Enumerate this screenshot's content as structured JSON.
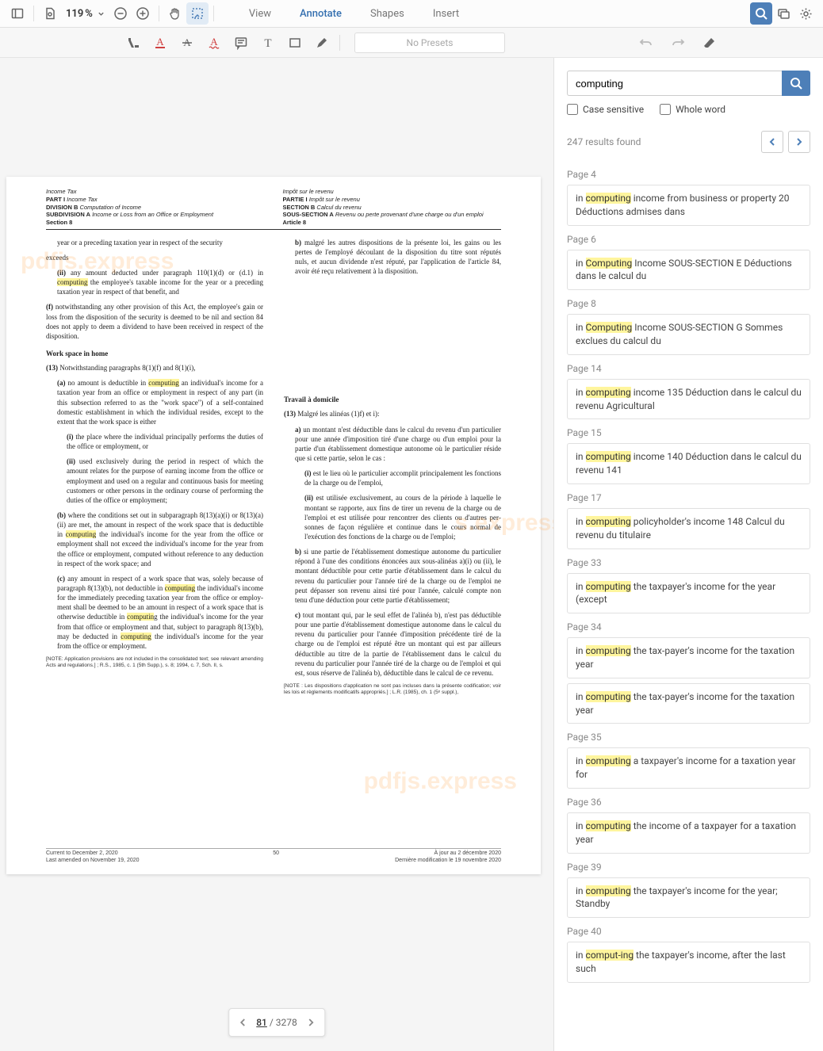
{
  "toolbar": {
    "zoom_value": "119",
    "zoom_suffix": " %",
    "modes": [
      "View",
      "Annotate",
      "Shapes",
      "Insert"
    ],
    "active_mode_index": 1,
    "presets_placeholder": "No Presets"
  },
  "pager": {
    "current": "81",
    "total": "3278"
  },
  "search": {
    "query": "computing",
    "case_sensitive_label": "Case sensitive",
    "whole_word_label": "Whole word",
    "results_count_text": "247 results found"
  },
  "results": [
    {
      "page": "Page 4",
      "items": [
        {
          "pre": "in ",
          "hl": "computing",
          "post": " income from business or property 20 Déductions admises dans"
        }
      ]
    },
    {
      "page": "Page 6",
      "items": [
        {
          "pre": "in ",
          "hl": "Computing",
          "post": " Income SOUS-SECTION E Déductions dans le calcul du"
        }
      ]
    },
    {
      "page": "Page 8",
      "items": [
        {
          "pre": "in ",
          "hl": "Computing",
          "post": " Income SOUS-SECTION G Sommes exclues du calcul du"
        }
      ]
    },
    {
      "page": "Page 14",
      "items": [
        {
          "pre": "in ",
          "hl": "computing",
          "post": " income 135 Déduction dans le calcul du revenu Agricultural"
        }
      ]
    },
    {
      "page": "Page 15",
      "items": [
        {
          "pre": "in ",
          "hl": "computing",
          "post": " income 140 Déduction dans le calcul du revenu 141"
        }
      ]
    },
    {
      "page": "Page 17",
      "items": [
        {
          "pre": "in ",
          "hl": "computing",
          "post": " policyholder's income 148 Calcul du revenu du titulaire"
        }
      ]
    },
    {
      "page": "Page 33",
      "items": [
        {
          "pre": "in ",
          "hl": "computing",
          "post": " the taxpayer's income for the year (except"
        }
      ]
    },
    {
      "page": "Page 34",
      "items": [
        {
          "pre": "in ",
          "hl": "computing",
          "post": " the tax-payer's income for the taxation year"
        },
        {
          "pre": "in ",
          "hl": "computing",
          "post": " the tax-payer's income for the taxation year"
        }
      ]
    },
    {
      "page": "Page 35",
      "items": [
        {
          "pre": "in ",
          "hl": "computing",
          "post": " a taxpayer's income for a taxation year for"
        }
      ]
    },
    {
      "page": "Page 36",
      "items": [
        {
          "pre": "in ",
          "hl": "computing",
          "post": " the income of a taxpayer for a taxation year"
        }
      ]
    },
    {
      "page": "Page 39",
      "items": [
        {
          "pre": "in ",
          "hl": "computing",
          "post": " the taxpayer's income for the year; Standby"
        }
      ]
    },
    {
      "page": "Page 40",
      "items": [
        {
          "pre": "in ",
          "hl": "comput-ing",
          "post": " the taxpayer's income, after the last such"
        }
      ]
    }
  ],
  "doc": {
    "header_left": {
      "l1": "Income Tax",
      "l2": "PART I",
      "l2t": " Income Tax",
      "l3": "DIVISION B",
      "l3t": " Computation of Income",
      "l4": "SUBDIVISION A",
      "l4t": " Income or Loss from an Office or Employment",
      "l5": "Section 8"
    },
    "header_right": {
      "l1": "Impôt sur le revenu",
      "l2": "PARTIE I",
      "l2t": " Impôt sur le revenu",
      "l3": "SECTION B",
      "l3t": " Calcul du revenu",
      "l4": "SOUS-SECTION A",
      "l4t": " Revenu ou perte provenant d'une charge ou d'un emploi",
      "l5": "Article 8"
    },
    "left": {
      "p1": "year or a preceding taxation year in respect of the security",
      "exceeds": "exceeds",
      "p_ii_a": "(ii)",
      "p_ii_b": " any amount deducted under paragraph 110(1)(d) or (d.1) in ",
      "p_ii_hl": "computing",
      "p_ii_c": " the employee's tax­able income for the year or a preceding taxation year in respect of that benefit, and",
      "p_f": "(f)",
      "p_f_t": " notwithstanding any other provision of this Act, the employee's gain or loss from the disposition of the security is deemed to be nil and section 84 does not apply to deem a dividend to have been received in re­spect of the disposition.",
      "head": "Work space in home",
      "p13": "(13)",
      "p13t": "  Notwithstanding paragraphs 8(1)(f) and 8(1)(i),",
      "pa_a": "(a)",
      "pa_b": "  no amount is deductible in ",
      "pa_hl": "computing",
      "pa_c": " an individu­al's income for a taxation year from an office or em­ployment in respect of any part (in this subsection re­ferred to as the \"work space\") of a self-contained domestic establishment in which the individual re­sides, except to the extent that the work space is either",
      "pi": "(i)",
      "pi_t": " the place where the individual principally per­forms the duties of the office or employment, or",
      "pii": "(ii)",
      "pii_t": " used exclusively during the period in respect of which the amount relates for the purpose of earning income from the office or employment and used on a regular and continuous basis for meeting cus­tomers or other persons in the ordinary course of performing the duties of the office or employment;",
      "pb_a": "(b)",
      "pb_b": "  where the conditions set out in subparagraph 8(13)(a)(i) or 8(13)(a)(ii) are met, the amount in re­spect of the work space that is deductible in ",
      "pb_hl1": "comput­ing",
      "pb_c": " the individual's income for the year from the office or employment shall not exceed the individual's in­come for the year from the office or employment, com­puted without reference to any deduction in respect of the work space; and",
      "pc_a": "(c)",
      "pc_b": "  any amount in respect of a work space that was, solely because of paragraph 8(13)(b), not deductible in ",
      "pc_hl1": "computing",
      "pc_c": " the individual's income for the immediate­ly preceding taxation year from the office or employ­ment shall be deemed to be an amount in respect of a work space that is otherwise deductible in ",
      "pc_hl2": "computin",
      "pc_d": "g the individual's income for the year from that office or employment and that, subject to paragraph 8(13)(b), may be deducted in ",
      "pc_hl3": "computing",
      "pc_e": " the individual's income for the year from the office or employment.",
      "note": "[NOTE: Application provisions are not included in the consolidated text; see relevant amending Acts and regulations.] ; R.S., 1985, c. 1 (5th Supp.), s. 8; 1994, c. 7, Sch. II, s."
    },
    "right": {
      "pb_a": "b)",
      "pb_t": "  malgré les autres dispositions de la présente loi, les gains ou les pertes de l'employé découlant de la dispo­sition du titre sont réputés nuls, et aucun dividende n'est réputé, par l'application de l'article 84, avoir été reçu relativement à la disposition.",
      "head": "Travail à domicile",
      "p13": "(13)",
      "p13t": "  Malgré les alinéas (1)f) et i):",
      "pa_a": "a)",
      "pa_t": "  un montant n'est déductible dans le calcul du reve­nu d'un particulier pour une année d'imposition tiré d'une charge ou d'un emploi pour la partie d'un éta­blissement domestique autonome où le particulier ré­side que si cette partie, selon le cas :",
      "pi": "(i)",
      "pi_t": "  est le lieu où le particulier accomplit principale­ment les fonctions de la charge ou de l'emploi,",
      "pii": "(ii)",
      "pii_t": "  est utilisée exclusivement, au cours de la pé­riode à laquelle le montant se rapporte, aux fins de tirer un revenu de la charge ou de l'emploi et est utilisée pour rencontrer des clients ou d'autres per­sonnes de façon régulière et continue dans le cours normal de l'exécution des fonctions de la charge ou de l'emploi;",
      "pb2_a": "b)",
      "pb2_t": "  si une partie de l'établissement domestique auto­nome du particulier répond à l'une des conditions énoncées aux sous-alinéas a)(i) ou (ii), le montant dé­ductible pour cette partie d'établissement dans le cal­cul du revenu du particulier pour l'année tiré de la charge ou de l'emploi ne peut dépasser son revenu ainsi tiré pour l'année, calculé compte non tenu d'une déduction pour cette partie d'établissement;",
      "pc2_a": "c)",
      "pc2_t": "  tout montant qui, par le seul effet de l'alinéa b), n'est pas déductible pour une partie d'établissement domestique autonome dans le calcul du revenu du particulier pour l'année d'imposition précédente tiré de la charge ou de l'emploi est réputé être un montant qui est par ailleurs déductible au titre de la partie de l'établissement dans le calcul du revenu du particulier pour l'année tiré de la charge ou de l'emploi et qui est, sous réserve de l'alinéa b), déductible dans le calcul de ce revenu.",
      "note": "[NOTE : Les dispositions d'application ne sont pas incluses dans la présente codifica­tion; voir les lois et règlements modificatifs appropriés.] ; L.R. (1985), ch. 1 (5ᵉ suppl.),"
    },
    "footer": {
      "left1": "Current to December 2, 2020",
      "center": "50",
      "right1": "À jour au 2 décembre 2020",
      "left2": "Last amended on November 19, 2020",
      "right2": "Dernière modification le 19 novembre 2020"
    }
  }
}
